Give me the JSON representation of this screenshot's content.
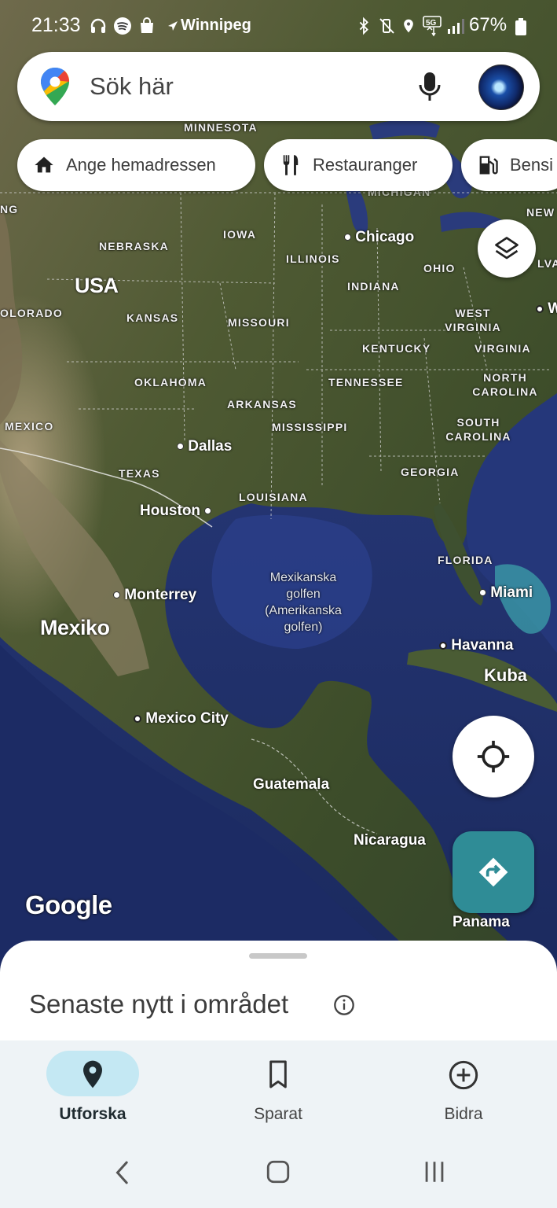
{
  "status_bar": {
    "time": "21:33",
    "location": "Winnipeg",
    "battery": "67%"
  },
  "search": {
    "placeholder": "Sök här"
  },
  "chips": [
    {
      "label": "Ange hemadressen",
      "icon": "home-icon"
    },
    {
      "label": "Restauranger",
      "icon": "restaurant-icon"
    },
    {
      "label": "Bensi",
      "icon": "gas-station-icon"
    }
  ],
  "map": {
    "states": [
      "MINNESOTA",
      "IOWA",
      "NEBRASKA",
      "ILLINOIS",
      "OHIO",
      "INDIANA",
      "KANSAS",
      "MISSOURI",
      "WEST VIRGINIA",
      "VIRGINIA",
      "KENTUCKY",
      "OKLAHOMA",
      "TENNESSEE",
      "NORTH CAROLINA",
      "ARKANSAS",
      "MISSISSIPPI",
      "SOUTH CAROLINA",
      "TEXAS",
      "LOUISIANA",
      "GEORGIA",
      "FLORIDA",
      "NG",
      "OLORADO",
      "MEXICO",
      "NEW",
      "LVAN",
      "MICHIGAN"
    ],
    "cities": [
      "Chicago",
      "Dallas",
      "Houston",
      "Monterrey",
      "Mexico City",
      "Miami",
      "Havanna",
      "W"
    ],
    "countries": [
      "USA",
      "Mexiko",
      "Kuba",
      "Guatemala",
      "Nicaragua",
      "Panama"
    ],
    "water": [
      "Mexikanska",
      "golfen",
      "(Amerikanska",
      "golfen)"
    ],
    "attribution": "Google"
  },
  "sheet": {
    "title": "Senaste nytt i området"
  },
  "nav": [
    {
      "label": "Utforska",
      "icon": "explore-pin-icon",
      "active": true
    },
    {
      "label": "Sparat",
      "icon": "bookmark-icon",
      "active": false
    },
    {
      "label": "Bidra",
      "icon": "add-circle-icon",
      "active": false
    }
  ],
  "colors": {
    "active_pill": "#c4e8f3",
    "directions_fab": "#2f8c96",
    "sea": "#1e2f66"
  }
}
